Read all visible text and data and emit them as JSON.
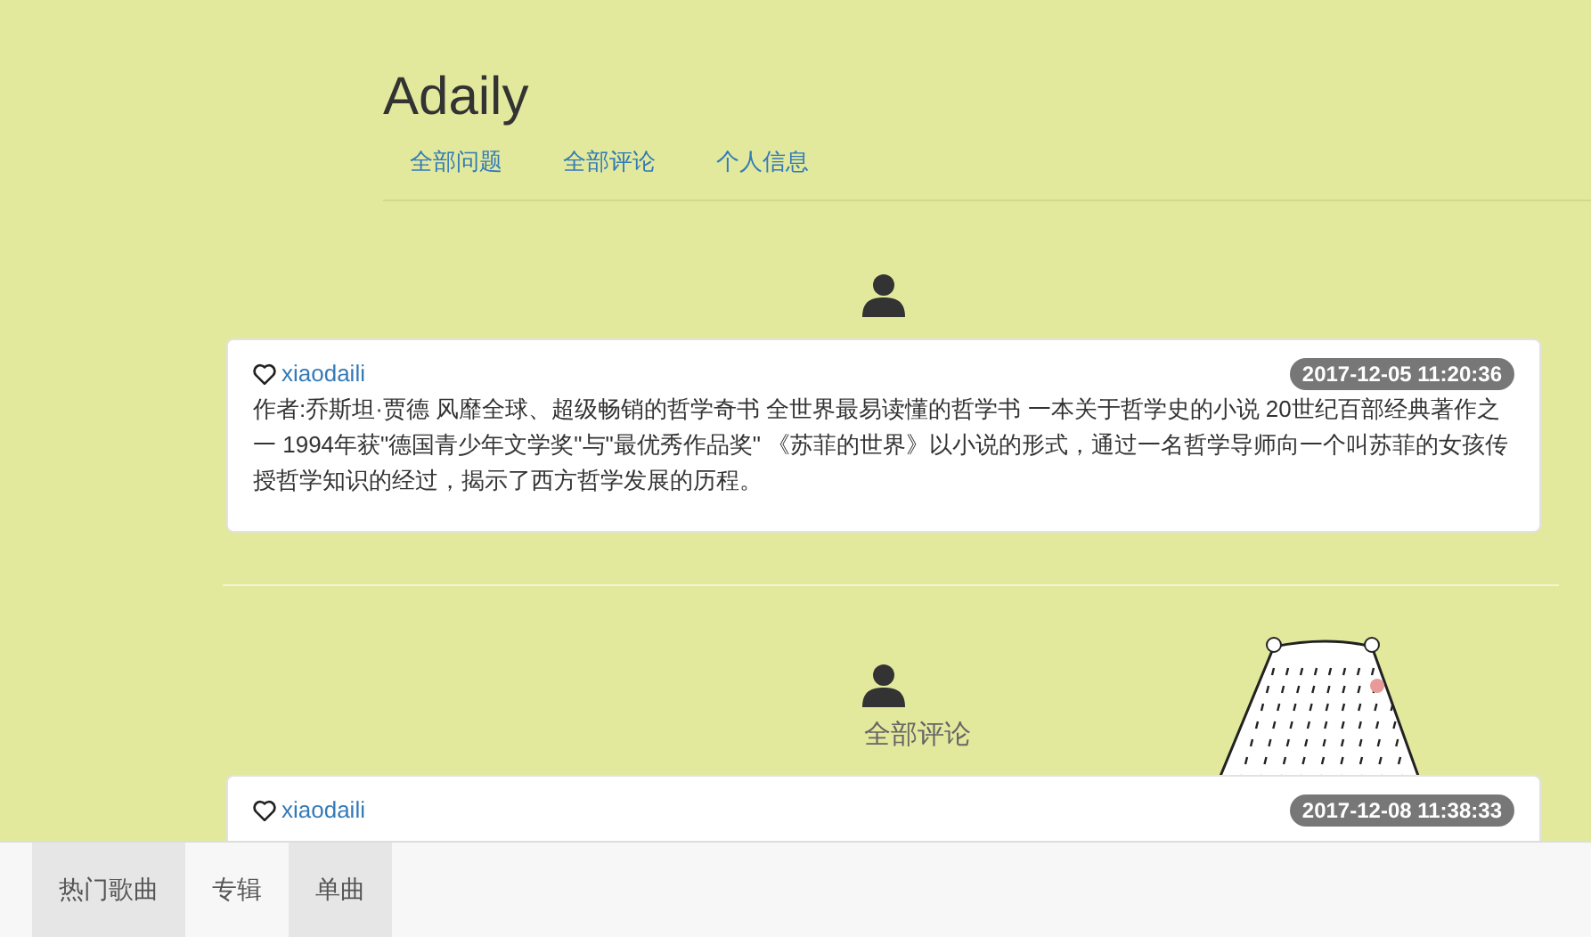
{
  "header": {
    "title": "Adaily",
    "nav": [
      {
        "label": "全部问题"
      },
      {
        "label": "全部评论"
      },
      {
        "label": "个人信息"
      }
    ]
  },
  "posts": [
    {
      "author": "xiaodaili",
      "time": "2017-12-05 11:20:36",
      "body": "作者:乔斯坦·贾德 风靡全球、超级畅销的哲学奇书 全世界最易读懂的哲学书 一本关于哲学史的小说 20世纪百部经典著作之一 1994年获\"德国青少年文学奖\"与\"最优秀作品奖\" 《苏菲的世界》以小说的形式，通过一名哲学导师向一个叫苏菲的女孩传授哲学知识的经过，揭示了西方哲学发展的历程。"
    }
  ],
  "section": {
    "label": "全部评论",
    "posts": [
      {
        "author": "xiaodaili",
        "time": "2017-12-08 11:38:33"
      }
    ]
  },
  "bottom_tabs": [
    {
      "label": "热门歌曲",
      "highlighted": true
    },
    {
      "label": "专辑",
      "highlighted": false
    },
    {
      "label": "单曲",
      "highlighted": true
    }
  ]
}
